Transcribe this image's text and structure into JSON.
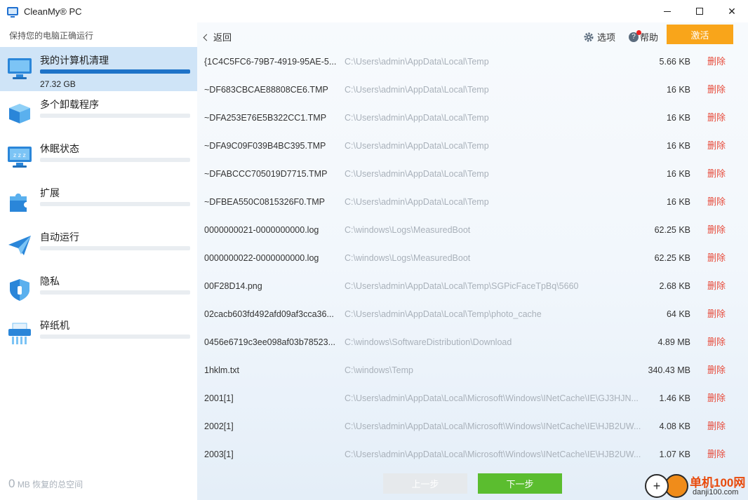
{
  "window": {
    "title": "CleanMy® PC",
    "controls": {
      "minimize": "—",
      "maximize": "□",
      "close": "✕"
    }
  },
  "sidebar": {
    "subtitle": "保持您的电脑正确运行",
    "items": [
      {
        "label": "我的计算机清理",
        "icon": "monitor-icon",
        "size": "27.32 GB",
        "progress": 1.0,
        "active": true
      },
      {
        "label": "多个卸载程序",
        "icon": "box-icon",
        "progress": 0
      },
      {
        "label": "休眠状态",
        "icon": "sleep-monitor-icon",
        "progress": 0
      },
      {
        "label": "扩展",
        "icon": "puzzle-icon",
        "progress": 0
      },
      {
        "label": "自动运行",
        "icon": "paper-plane-icon",
        "progress": 0
      },
      {
        "label": "隐私",
        "icon": "shield-icon",
        "progress": 0
      },
      {
        "label": "碎纸机",
        "icon": "shredder-icon",
        "progress": 0
      }
    ],
    "footer": {
      "amount": "0",
      "text": "MB 恢复的总空间"
    }
  },
  "header": {
    "back": "返回",
    "options": "选项",
    "help": "帮助",
    "activate": "激活"
  },
  "files": [
    {
      "name": "{1C4C5FC6-79B7-4919-95AE-5...",
      "path": "C:\\Users\\admin\\AppData\\Local\\Temp",
      "size": "5.66 KB",
      "action": "删除"
    },
    {
      "name": "~DF683CBCAE88808CE6.TMP",
      "path": "C:\\Users\\admin\\AppData\\Local\\Temp",
      "size": "16 KB",
      "action": "删除"
    },
    {
      "name": "~DFA253E76E5B322CC1.TMP",
      "path": "C:\\Users\\admin\\AppData\\Local\\Temp",
      "size": "16 KB",
      "action": "删除"
    },
    {
      "name": "~DFA9C09F039B4BC395.TMP",
      "path": "C:\\Users\\admin\\AppData\\Local\\Temp",
      "size": "16 KB",
      "action": "删除"
    },
    {
      "name": "~DFABCCC705019D7715.TMP",
      "path": "C:\\Users\\admin\\AppData\\Local\\Temp",
      "size": "16 KB",
      "action": "删除"
    },
    {
      "name": "~DFBEA550C0815326F0.TMP",
      "path": "C:\\Users\\admin\\AppData\\Local\\Temp",
      "size": "16 KB",
      "action": "删除"
    },
    {
      "name": "0000000021-0000000000.log",
      "path": "C:\\windows\\Logs\\MeasuredBoot",
      "size": "62.25 KB",
      "action": "删除"
    },
    {
      "name": "0000000022-0000000000.log",
      "path": "C:\\windows\\Logs\\MeasuredBoot",
      "size": "62.25 KB",
      "action": "删除"
    },
    {
      "name": "00F28D14.png",
      "path": "C:\\Users\\admin\\AppData\\Local\\Temp\\SGPicFaceTpBq\\5660",
      "size": "2.68 KB",
      "action": "删除"
    },
    {
      "name": "02cacb603fd492afd09af3cca36...",
      "path": "C:\\Users\\admin\\AppData\\Local\\Temp\\photo_cache",
      "size": "64 KB",
      "action": "删除"
    },
    {
      "name": "0456e6719c3ee098af03b78523...",
      "path": "C:\\windows\\SoftwareDistribution\\Download",
      "size": "4.89 MB",
      "action": "删除"
    },
    {
      "name": "1hklm.txt",
      "path": "C:\\windows\\Temp",
      "size": "340.43 MB",
      "action": "删除"
    },
    {
      "name": "2001[1]",
      "path": "C:\\Users\\admin\\AppData\\Local\\Microsoft\\Windows\\INetCache\\IE\\GJ3HJN...",
      "size": "1.46 KB",
      "action": "删除"
    },
    {
      "name": "2002[1]",
      "path": "C:\\Users\\admin\\AppData\\Local\\Microsoft\\Windows\\INetCache\\IE\\HJB2UW...",
      "size": "4.08 KB",
      "action": "删除"
    },
    {
      "name": "2003[1]",
      "path": "C:\\Users\\admin\\AppData\\Local\\Microsoft\\Windows\\INetCache\\IE\\HJB2UW...",
      "size": "1.07 KB",
      "action": "删除"
    }
  ],
  "footer_buttons": {
    "prev": "上一步",
    "next": "下一步"
  },
  "watermark": {
    "title": "单机100网",
    "sub": "danji100.com"
  },
  "colors": {
    "accent": "#1e73c8",
    "activate": "#f9a51a",
    "next": "#5bbd2f",
    "delete": "#e74c3c",
    "active_nav": "#cfe4f7"
  }
}
